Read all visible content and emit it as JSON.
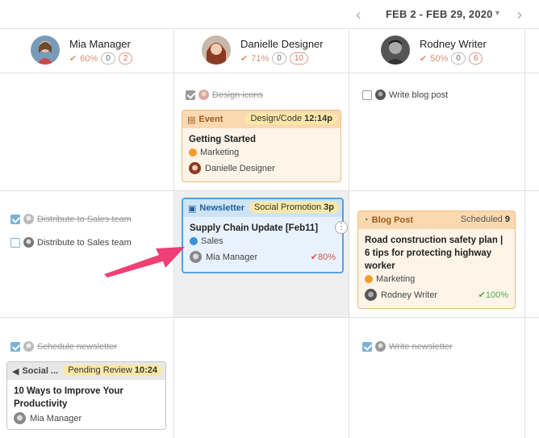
{
  "header": {
    "date_range": "FEB 2 - FEB 29, 2020",
    "prev_icon": "chevron-left-icon",
    "next_icon": "chevron-right-icon"
  },
  "people": [
    {
      "name": "Mia Manager",
      "pct": "60%",
      "count_a": "0",
      "count_b": "2"
    },
    {
      "name": "Danielle Designer",
      "pct": "71%",
      "count_a": "0",
      "count_b": "10"
    },
    {
      "name": "Rodney Writer",
      "pct": "50%",
      "count_a": "0",
      "count_b": "6"
    }
  ],
  "tasks": {
    "design_icons": "Design icons",
    "write_blog_post": "Write blog post",
    "distribute_done": "Distribute to Sales team",
    "distribute_open": "Distribute to Sales team",
    "schedule_newsletter": "Schedule newsletter",
    "write_newsletter": "Write newsletter"
  },
  "cards": {
    "event": {
      "type": "Event",
      "badge_label": "Design/Code",
      "badge_time": "12:14p",
      "title": "Getting Started",
      "tag": "Marketing",
      "owner": "Danielle Designer"
    },
    "newsletter": {
      "type": "Newsletter",
      "badge_label": "Social Promotion",
      "badge_time": "3p",
      "title": "Supply Chain Update [Feb11]",
      "tag": "Sales",
      "owner": "Mia Manager",
      "pct": "80%",
      "menu_glyph": "⋮"
    },
    "blog": {
      "type": "Blog Post",
      "status_label": "Scheduled",
      "status_count": "9",
      "title": "Road construction safety plan | 6 tips for protecting highway worker",
      "tag": "Marketing",
      "owner": "Rodney Writer",
      "pct": "100%"
    },
    "social": {
      "type": "Social ...",
      "badge_label": "Pending Review",
      "badge_time": "10:24",
      "title": "10 Ways to Improve Your Productivity",
      "owner": "Mia Manager"
    }
  },
  "colors": {
    "accent_orange": "#f4b97e",
    "accent_blue": "#5aa0e0",
    "arrow_pink": "#ef3f73",
    "tag_orange": "#f29c2b",
    "tag_blue": "#3b8fe0",
    "pct_green": "#4caf50",
    "pct_red": "#d9534f"
  }
}
